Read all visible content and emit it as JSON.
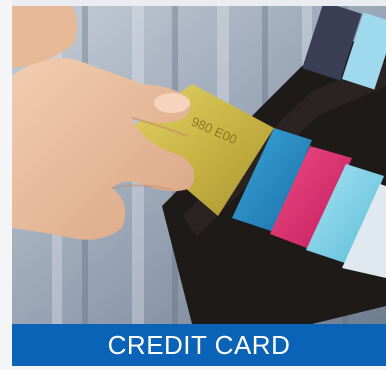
{
  "caption": {
    "text": "CREDIT CARD"
  },
  "photo": {
    "subject": "hand-pulling-gold-card-from-wallet",
    "gold_card_embossing": "980 E00"
  },
  "colors": {
    "caption_bar": "#0b63b8",
    "caption_text": "#ffffff",
    "gold_card": "#c9b544",
    "wallet": "#1e1a18"
  }
}
